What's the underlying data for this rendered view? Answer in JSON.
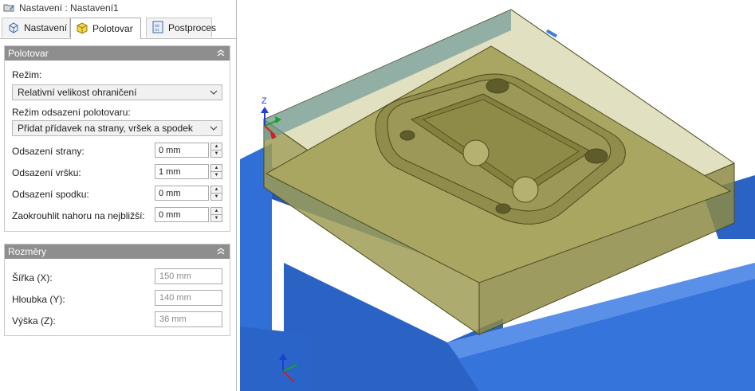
{
  "window": {
    "title": "Nastavení : Nastavení1"
  },
  "tabs": [
    {
      "label": "Nastavení",
      "icon": "setup-icon",
      "active": false
    },
    {
      "label": "Polotovar",
      "icon": "stock-icon",
      "active": true
    },
    {
      "label": "Postproces",
      "icon": "post-process-icon",
      "active": false
    }
  ],
  "stock_section": {
    "title": "Polotovar",
    "mode_label": "Režim:",
    "mode_value": "Relativní velikost ohraničení",
    "offset_mode_label": "Režim odsazení polotovaru:",
    "offset_mode_value": "Přidat přídavek na strany, vršek a spodek",
    "side_offset_label": "Odsazení strany:",
    "side_offset_value": "0 mm",
    "top_offset_label": "Odsazení vršku:",
    "top_offset_value": "1 mm",
    "bottom_offset_label": "Odsazení spodku:",
    "bottom_offset_value": "0 mm",
    "round_up_label": "Zaokrouhlit nahoru na nejbližší:",
    "round_up_value": "0 mm"
  },
  "dimensions_section": {
    "title": "Rozměry",
    "width_label": "Šířka (X):",
    "width_value": "150 mm",
    "depth_label": "Hloubka (Y):",
    "depth_value": "140 mm",
    "height_label": "Výška (Z):",
    "height_value": "36 mm"
  },
  "viewport": {
    "axis_z_label": "Z",
    "colors": {
      "fixture": "#2f6fd6",
      "stock": "#b9b77a",
      "part": "#8f8c4c",
      "edge": "#4d4a1e"
    }
  }
}
